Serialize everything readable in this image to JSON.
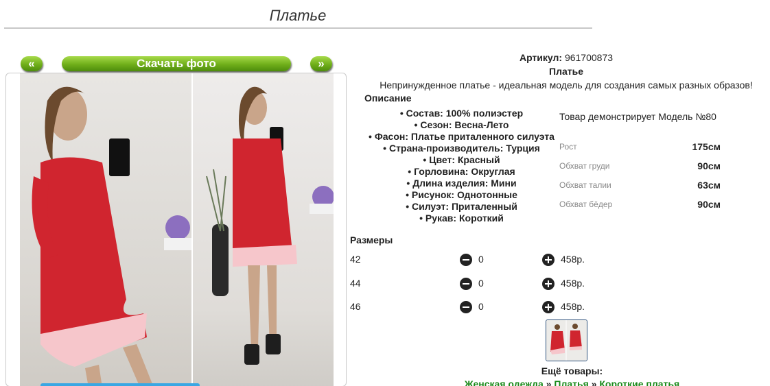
{
  "page": {
    "title": "Платье"
  },
  "gallery": {
    "prev_label": "«",
    "download_label": "Скачать фото",
    "next_label": "»"
  },
  "product": {
    "article_label": "Артикул:",
    "article_value": "961700873",
    "name": "Платье",
    "tagline": "Непринужденное платье - идеальная модель для создания самых разных образов!",
    "description_heading": "Описание",
    "features": [
      "Состав: 100% полиэстер",
      "Сезон: Весна-Лето",
      "Фасон: Платье приталенного силуэта",
      "Страна-производитель: Турция",
      "Цвет: Красный",
      "Горловина: Округлая",
      "Длина изделия: Мини",
      "Рисунок: Однотонные",
      "Силуэт: Приталенный",
      "Рукав: Короткий"
    ]
  },
  "model": {
    "caption": "Товар демонстрирует Модель №80",
    "measurements": [
      {
        "label": "Рост",
        "value": "175см"
      },
      {
        "label": "Обхват груди",
        "value": "90см"
      },
      {
        "label": "Обхват талии",
        "value": "63см"
      },
      {
        "label": "Обхват бёдер",
        "value": "90см"
      }
    ]
  },
  "sizes": {
    "heading": "Размеры",
    "rows": [
      {
        "size": "42",
        "qty": "0",
        "price": "458р."
      },
      {
        "size": "44",
        "qty": "0",
        "price": "458р."
      },
      {
        "size": "46",
        "qty": "0",
        "price": "458р."
      }
    ]
  },
  "more": {
    "heading": "Ещё товары:",
    "breadcrumbs": [
      "Женская одежда",
      "Платья",
      "Короткие платья"
    ],
    "separator": "»"
  },
  "colors": {
    "accent_green": "#6fae1a",
    "link_green": "#1a8a1a",
    "dress_red": "#d0252f"
  }
}
